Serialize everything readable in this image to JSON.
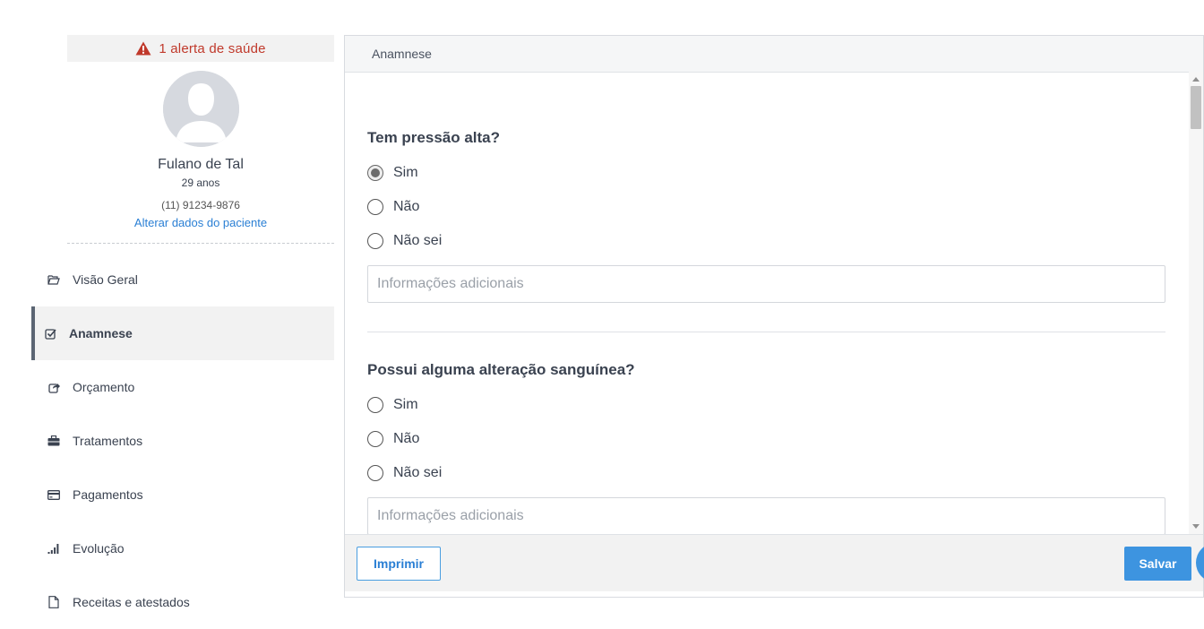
{
  "alert": {
    "icon": "warning-triangle-icon",
    "text": "1 alerta de saúde",
    "color": "#c0392b"
  },
  "patient": {
    "avatar": "user-avatar-placeholder",
    "name": "Fulano de Tal",
    "age": "29 anos",
    "phone": "(11) 91234-9876",
    "edit_link": "Alterar dados do paciente"
  },
  "nav": {
    "items": [
      {
        "label": "Visão Geral",
        "icon": "folder-open-icon",
        "active": false
      },
      {
        "label": "Anamnese",
        "icon": "check-square-icon",
        "active": true
      },
      {
        "label": "Orçamento",
        "icon": "share-square-icon",
        "active": false
      },
      {
        "label": "Tratamentos",
        "icon": "briefcase-icon",
        "active": false
      },
      {
        "label": "Pagamentos",
        "icon": "credit-card-icon",
        "active": false
      },
      {
        "label": "Evolução",
        "icon": "signal-bars-icon",
        "active": false
      },
      {
        "label": "Receitas e atestados",
        "icon": "file-icon",
        "active": false
      }
    ]
  },
  "panel": {
    "title": "Anamnese",
    "questions": [
      {
        "text": "Tem pressão alta?",
        "options": [
          "Sim",
          "Não",
          "Não sei"
        ],
        "selected": "Sim",
        "notes_placeholder": "Informações adicionais"
      },
      {
        "text": "Possui alguma alteração sanguínea?",
        "options": [
          "Sim",
          "Não",
          "Não sei"
        ],
        "selected": null,
        "notes_placeholder": "Informações adicionais"
      }
    ],
    "print_label": "Imprimir",
    "save_label": "Salvar"
  },
  "colors": {
    "accent": "#3d94e0",
    "link": "#2a7fd4",
    "active_bar": "#5b6573"
  }
}
